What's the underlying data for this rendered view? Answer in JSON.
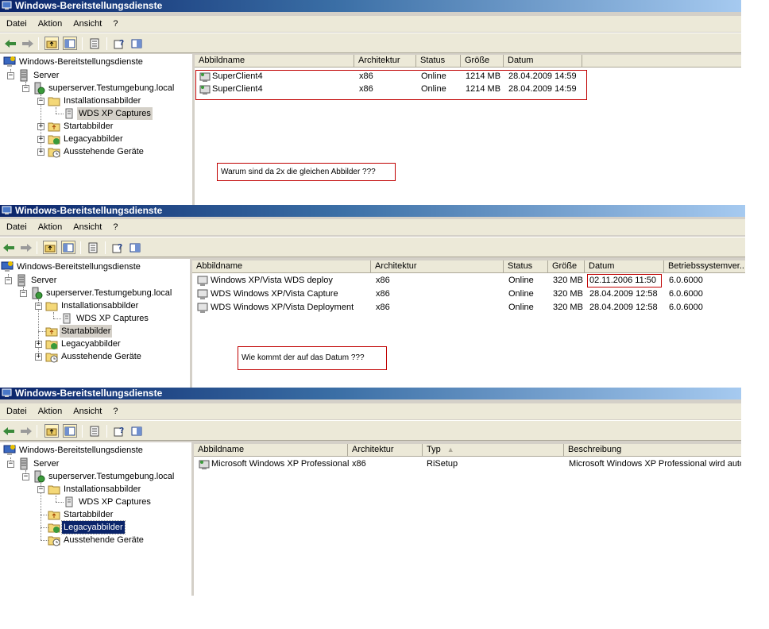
{
  "window_title": "Windows-Bereitstellungsdienste",
  "menu": [
    "Datei",
    "Aktion",
    "Ansicht",
    "?"
  ],
  "tree_labels": {
    "root": "Windows-Bereitstellungsdienste",
    "server": "Server",
    "host": "superserver.Testumgebung.local",
    "install": "Installationsabbilder",
    "capture_group": "WDS XP Captures",
    "boot": "Startabbilder",
    "legacy": "Legacyabbilder",
    "pending": "Ausstehende Geräte"
  },
  "panel1": {
    "columns": [
      "Abbildname",
      "Architektur",
      "Status",
      "Größe",
      "Datum"
    ],
    "rows": [
      [
        "SuperClient4",
        "x86",
        "Online",
        "1214 MB",
        "28.04.2009 14:59"
      ],
      [
        "SuperClient4",
        "x86",
        "Online",
        "1214 MB",
        "28.04.2009 14:59"
      ]
    ],
    "annotation": "Warum sind da 2x die gleichen Abbilder ???"
  },
  "panel2": {
    "columns": [
      "Abbildname",
      "Architektur",
      "Status",
      "Größe",
      "Datum",
      "Betriebssystemver..."
    ],
    "rows": [
      [
        "Windows XP/Vista WDS deploy",
        "x86",
        "Online",
        "320 MB",
        "02.11.2006 11:50",
        "6.0.6000"
      ],
      [
        "WDS Windows XP/Vista Capture",
        "x86",
        "Online",
        "320 MB",
        "28.04.2009 12:58",
        "6.0.6000"
      ],
      [
        "WDS Windows XP/Vista Deployment",
        "x86",
        "Online",
        "320 MB",
        "28.04.2009 12:58",
        "6.0.6000"
      ]
    ],
    "annotation": "Wie kommt der auf das Datum ???"
  },
  "panel3": {
    "columns": [
      "Abbildname",
      "Architektur",
      "Typ",
      "Beschreibung"
    ],
    "rows": [
      [
        "Microsoft Windows XP Professional",
        "x86",
        "RiSetup",
        "Microsoft Windows XP Professional wird autom"
      ]
    ]
  },
  "colors": {
    "title_gradient_start": "#0a246a",
    "title_gradient_end": "#a6caf0",
    "annotation_border": "#c00000",
    "selection": "#0a246a"
  }
}
